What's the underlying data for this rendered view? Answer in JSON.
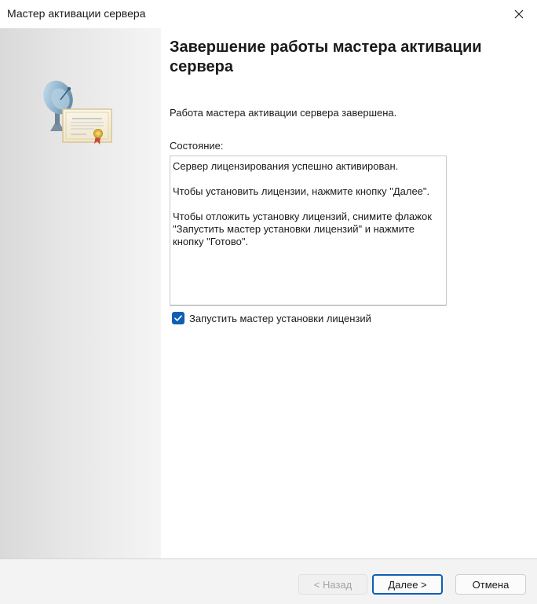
{
  "window": {
    "title": "Мастер активации сервера",
    "close_icon": "close-icon"
  },
  "side_image": {
    "icon": "license-certificate-satellite-icon"
  },
  "main": {
    "heading": "Завершение работы мастера активации сервера",
    "description": "Работа мастера активации сервера завершена.",
    "status_label": "Состояние:",
    "status_lines": [
      "Сервер лицензирования успешно активирован.",
      "Чтобы установить лицензии, нажмите кнопку \"Далее\".",
      "Чтобы отложить установку лицензий, снимите флажок \"Запустить мастер установки лицензий\" и нажмите кнопку \"Готово\"."
    ],
    "checkbox": {
      "label": "Запустить мастер установки лицензий",
      "checked": true
    }
  },
  "footer": {
    "back_label": "< Назад",
    "next_label": "Далее >",
    "cancel_label": "Отмена"
  },
  "colors": {
    "accent": "#0f5fb5",
    "footer_bg": "#f3f3f3",
    "disabled_text": "#a3a3a3"
  }
}
